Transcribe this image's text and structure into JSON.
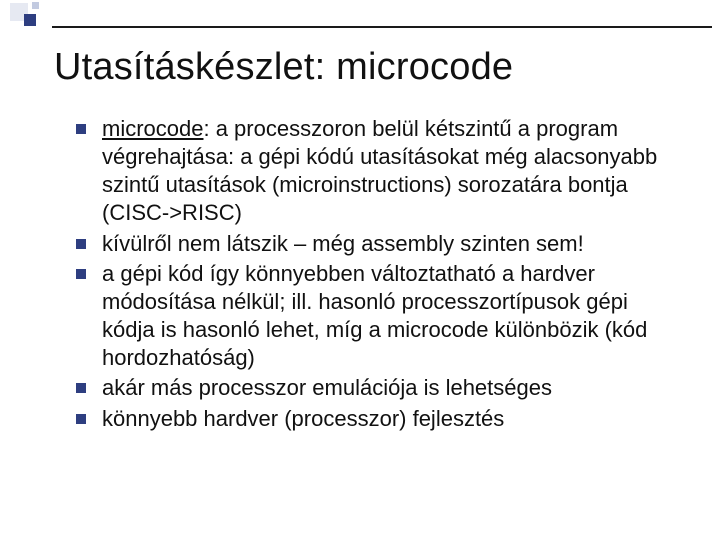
{
  "title": "Utasításkészlet: microcode",
  "bullets": [
    {
      "lead_underlined": "microcode",
      "rest": ": a processzoron belül kétszintű a program végrehajtása: a gépi kódú utasításokat még alacsonyabb szintű utasítások (microinstructions) sorozatára bontja (CISC->RISC)"
    },
    {
      "lead_underlined": "",
      "rest": "kívülről nem látszik – még assembly szinten sem!"
    },
    {
      "lead_underlined": "",
      "rest": "a gépi kód így könnyebben változtatható a hardver módosítása nélkül; ill. hasonló processzortípusok gépi kódja is hasonló lehet, míg a microcode különbözik (kód hordozhatóság)"
    },
    {
      "lead_underlined": "",
      "rest": "akár más processzor emulációja is lehetséges"
    },
    {
      "lead_underlined": "",
      "rest": "könnyebb hardver (processzor) fejlesztés"
    }
  ]
}
